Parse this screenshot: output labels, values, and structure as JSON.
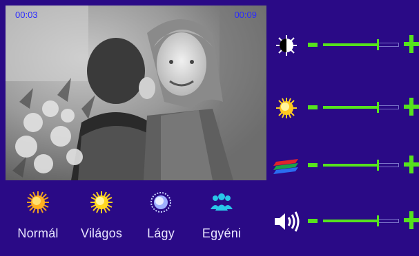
{
  "video": {
    "elapsed": "00:03",
    "total": "00:09"
  },
  "modes": [
    {
      "label": "Normál",
      "icon": "sun-icon"
    },
    {
      "label": "Világos",
      "icon": "bright-sun-icon"
    },
    {
      "label": "Lágy",
      "icon": "soft-light-icon"
    },
    {
      "label": "Egyéni",
      "icon": "people-icon"
    }
  ],
  "controls": [
    {
      "name": "contrast",
      "icon": "contrast-icon",
      "level": 0.72
    },
    {
      "name": "brightness",
      "icon": "sun-icon",
      "level": 0.72
    },
    {
      "name": "color",
      "icon": "color-layers-icon",
      "level": 0.72
    },
    {
      "name": "volume",
      "icon": "speaker-icon",
      "level": 0.72
    }
  ],
  "colors": {
    "background": "#2a0a86",
    "accent": "#56e31d",
    "timestamp": "#2b2bff"
  }
}
